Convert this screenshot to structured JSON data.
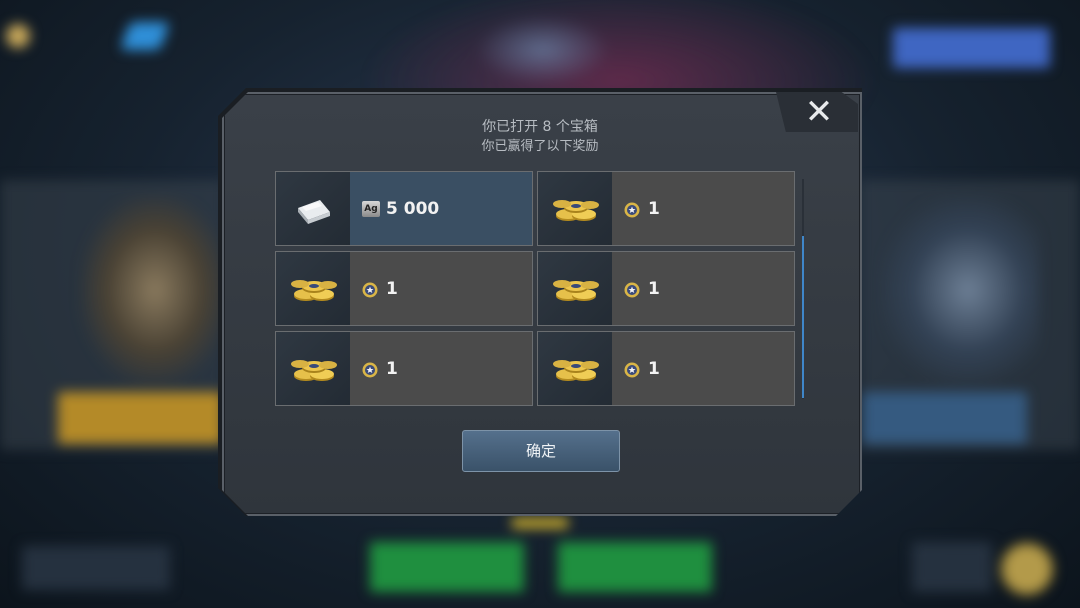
{
  "dialog": {
    "title_line1": "你已打开 8 个宝箱",
    "title_line2": "你已赢得了以下奖励",
    "close_glyph": "✕",
    "confirm_label": "确定"
  },
  "rewards": [
    {
      "item": "silver-bar",
      "currency_tag": "Ag",
      "currency": "silver",
      "amount": "5 000",
      "highlighted": true
    },
    {
      "item": "gold-coins",
      "currency": "coin",
      "amount": "1",
      "highlighted": false
    },
    {
      "item": "gold-coins",
      "currency": "coin",
      "amount": "1",
      "highlighted": false
    },
    {
      "item": "gold-coins",
      "currency": "coin",
      "amount": "1",
      "highlighted": false
    },
    {
      "item": "gold-coins",
      "currency": "coin",
      "amount": "1",
      "highlighted": false
    },
    {
      "item": "gold-coins",
      "currency": "coin",
      "amount": "1",
      "highlighted": false
    }
  ],
  "colors": {
    "highlight_cell": "#3a4f63",
    "cell": "#4b4b4b",
    "scroll_thumb": "#3f86c9",
    "confirm_button": "#4a637c"
  }
}
